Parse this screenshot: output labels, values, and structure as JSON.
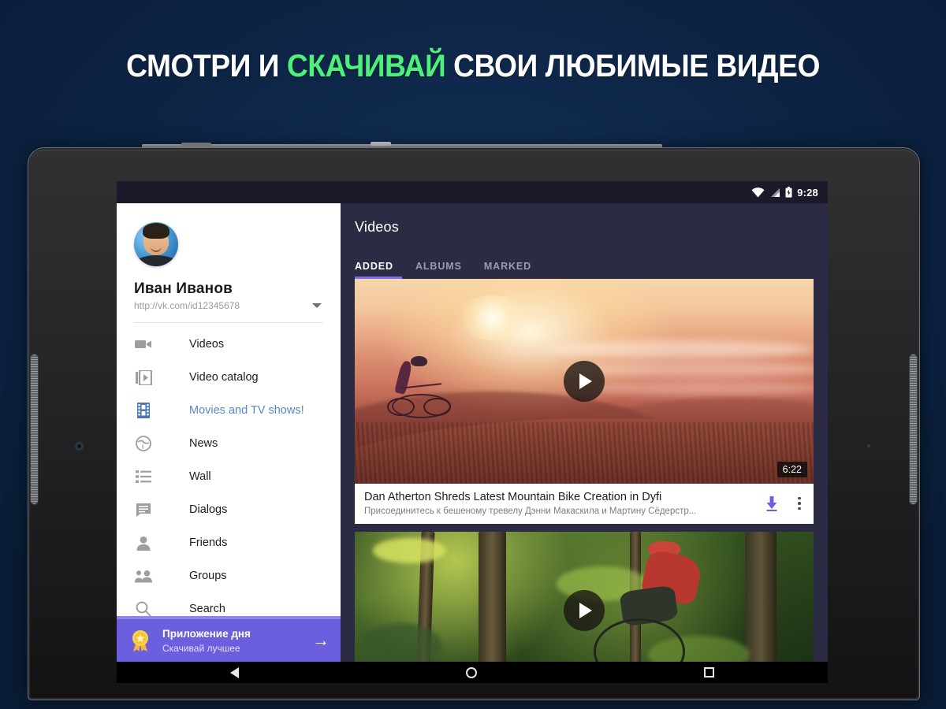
{
  "headline": {
    "before": "СМОТРИ И ",
    "accent": "СКАЧИВАЙ",
    "after": " СВОИ ЛЮБИМЫЕ ВИДЕО",
    "accent_color": "#4cf07a"
  },
  "status_bar": {
    "time": "9:28",
    "wifi_icon": "wifi-icon",
    "signal_icon": "signal-icon",
    "battery_icon": "battery-charging-icon"
  },
  "drawer": {
    "user": {
      "name": "Иван Иванов",
      "url": "http://vk.com/id12345678",
      "avatar": "user-avatar",
      "expand_icon": "chevron-down-icon"
    },
    "items": [
      {
        "label": "Videos",
        "icon": "video-camera-icon",
        "active": false
      },
      {
        "label": "Video catalog",
        "icon": "video-catalog-icon",
        "active": false
      },
      {
        "label": "Movies and TV shows!",
        "icon": "film-strip-icon",
        "active": true
      },
      {
        "label": "News",
        "icon": "globe-icon",
        "active": false
      },
      {
        "label": "Wall",
        "icon": "list-icon",
        "active": false
      },
      {
        "label": "Dialogs",
        "icon": "chat-bubble-icon",
        "active": false
      },
      {
        "label": "Friends",
        "icon": "person-icon",
        "active": false
      },
      {
        "label": "Groups",
        "icon": "people-icon",
        "active": false
      },
      {
        "label": "Search",
        "icon": "search-icon",
        "active": false
      }
    ],
    "promo": {
      "title": "Приложение дня",
      "subtitle": "Скачивай лучшее",
      "icon": "medal-award-icon",
      "arrow_icon": "arrow-right-icon",
      "bg_color": "#6b5fe0"
    }
  },
  "content": {
    "title": "Videos",
    "accent_color": "#7b6ff0",
    "tabs": [
      {
        "label": "ADDED",
        "active": true
      },
      {
        "label": "ALBUMS",
        "active": false
      },
      {
        "label": "MARKED",
        "active": false
      }
    ],
    "videos": [
      {
        "title": "Dan Atherton Shreds Latest Mountain Bike Creation in Dyfi",
        "subtitle": "Присоединитесь к бешеному тревелу  Дэнни Макаскила и Мартину Сёдерстр...",
        "duration": "6:22",
        "play_icon": "play-icon",
        "download_icon": "download-icon",
        "menu_icon": "more-vertical-icon",
        "scene": "sunset-mountain-bike"
      },
      {
        "title": "",
        "subtitle": "",
        "duration": "",
        "play_icon": "play-icon",
        "download_icon": "download-icon",
        "menu_icon": "more-vertical-icon",
        "scene": "forest-mountain-bike"
      }
    ]
  },
  "nav_bar": {
    "back": "back-nav-button",
    "home": "home-nav-button",
    "recents": "recents-nav-button"
  }
}
